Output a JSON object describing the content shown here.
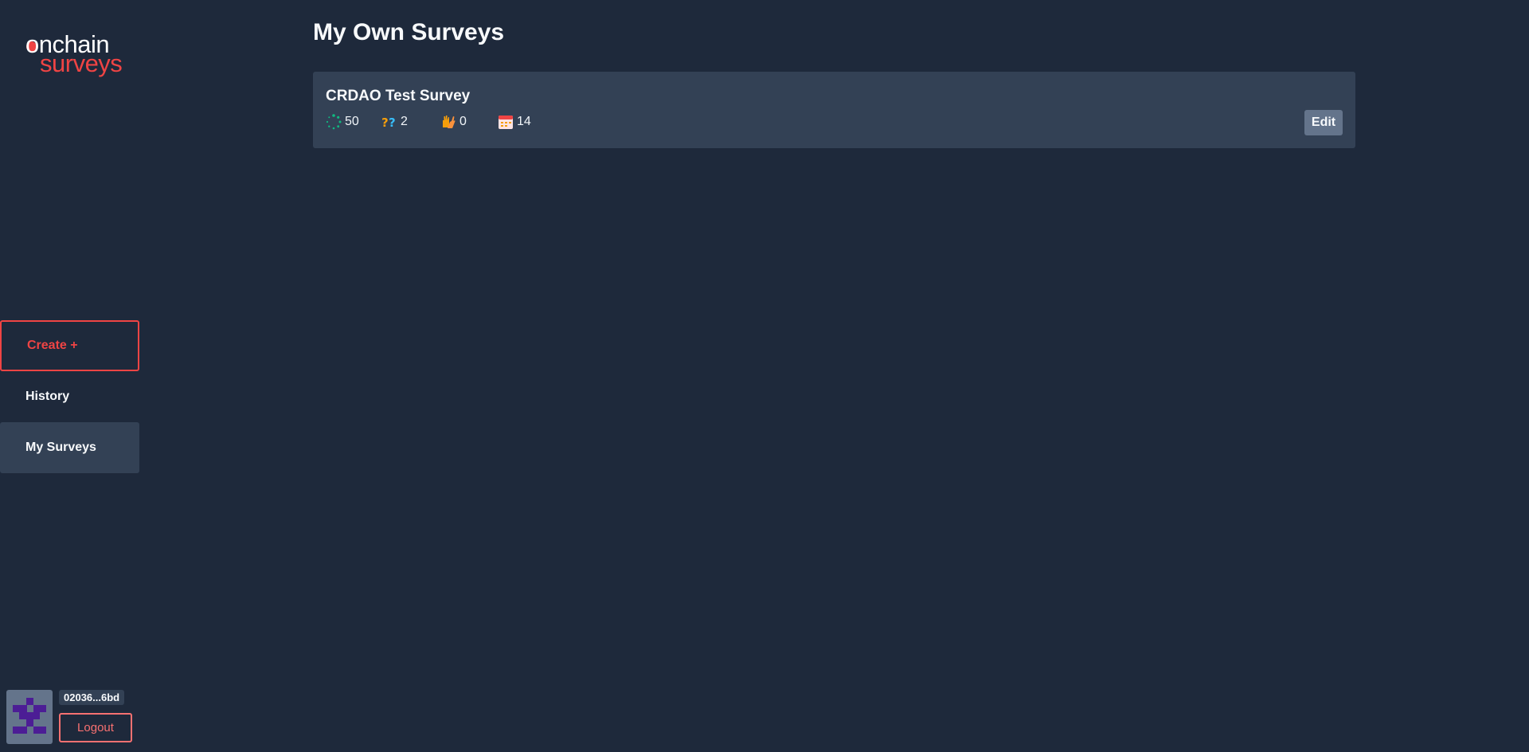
{
  "brand": {
    "logo_line1": "onchain",
    "logo_line2": "surveys",
    "accent_color": "#ef4444"
  },
  "sidebar": {
    "items": [
      {
        "label": "Create +",
        "icon": null
      },
      {
        "label": "History"
      },
      {
        "label": "My Surveys",
        "active": true
      }
    ]
  },
  "user": {
    "address_short": "02036...6bd",
    "logout_label": "Logout",
    "avatar_icon": "identicon-avatar"
  },
  "main": {
    "title": "My Own Surveys",
    "surveys": [
      {
        "title": "CRDAO Test Survey",
        "stats": [
          {
            "icon": "loading-spinner-icon",
            "value": "50"
          },
          {
            "icon": "question-marks-icon",
            "value": "2"
          },
          {
            "icon": "raised-hands-icon",
            "value": "0"
          },
          {
            "icon": "calendar-icon",
            "value": "14"
          }
        ],
        "edit_label": "Edit"
      }
    ]
  }
}
